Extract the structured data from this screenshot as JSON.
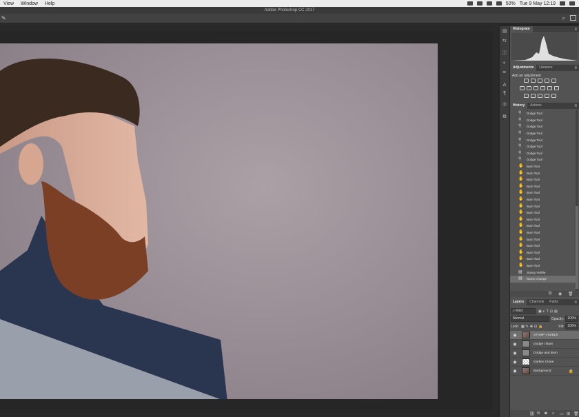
{
  "menubar": {
    "items": [
      "View",
      "Window",
      "Help"
    ],
    "battery": "50%",
    "clock": "Tue 9 May  12:19"
  },
  "app": {
    "title": "Adobe Photoshop CC 2017"
  },
  "panels": {
    "histogram": {
      "tab": "Histogram"
    },
    "adjustments": {
      "tabs": [
        "Adjustments",
        "Libraries"
      ],
      "add_label": "Add an adjustment"
    },
    "history": {
      "tabs": [
        "History",
        "Actions"
      ],
      "items": [
        {
          "label": "Dodge Tool",
          "icon": "dodge-icon"
        },
        {
          "label": "Dodge Tool",
          "icon": "dodge-icon"
        },
        {
          "label": "Dodge Tool",
          "icon": "dodge-icon"
        },
        {
          "label": "Dodge Tool",
          "icon": "dodge-icon"
        },
        {
          "label": "Dodge Tool",
          "icon": "dodge-icon"
        },
        {
          "label": "Dodge Tool",
          "icon": "dodge-icon"
        },
        {
          "label": "Dodge Tool",
          "icon": "dodge-icon"
        },
        {
          "label": "Dodge Tool",
          "icon": "dodge-icon"
        },
        {
          "label": "Burn Tool",
          "icon": "burn-icon"
        },
        {
          "label": "Burn Tool",
          "icon": "burn-icon"
        },
        {
          "label": "Burn Tool",
          "icon": "burn-icon"
        },
        {
          "label": "Burn Tool",
          "icon": "burn-icon"
        },
        {
          "label": "Burn Tool",
          "icon": "burn-icon"
        },
        {
          "label": "Burn Tool",
          "icon": "burn-icon"
        },
        {
          "label": "Burn Tool",
          "icon": "burn-icon"
        },
        {
          "label": "Burn Tool",
          "icon": "burn-icon"
        },
        {
          "label": "Burn Tool",
          "icon": "burn-icon"
        },
        {
          "label": "Burn Tool",
          "icon": "burn-icon"
        },
        {
          "label": "Burn Tool",
          "icon": "burn-icon"
        },
        {
          "label": "Burn Tool",
          "icon": "burn-icon"
        },
        {
          "label": "Burn Tool",
          "icon": "burn-icon"
        },
        {
          "label": "Burn Tool",
          "icon": "burn-icon"
        },
        {
          "label": "Burn Tool",
          "icon": "burn-icon"
        },
        {
          "label": "Burn Tool",
          "icon": "burn-icon"
        },
        {
          "label": "Stamp Visible",
          "icon": "stamp-icon"
        },
        {
          "label": "Name Change",
          "icon": "stamp-icon",
          "selected": true
        }
      ]
    },
    "layers": {
      "tabs": [
        "Layers",
        "Channels",
        "Paths"
      ],
      "filter": "Kind",
      "blend_mode": "Normal",
      "opacity_label": "Opacity:",
      "opacity": "100%",
      "lock_label": "Lock:",
      "fill_label": "Fill:",
      "fill": "100%",
      "items": [
        {
          "name": "STAMP VISIBLE",
          "thumb": "img",
          "selected": true
        },
        {
          "name": "Dodge / Burn",
          "thumb": "gray"
        },
        {
          "name": "Dodge and Burn",
          "thumb": "gray"
        },
        {
          "name": "Darken Clone",
          "thumb": "check"
        },
        {
          "name": "Background",
          "thumb": "img",
          "locked": true
        }
      ]
    }
  }
}
